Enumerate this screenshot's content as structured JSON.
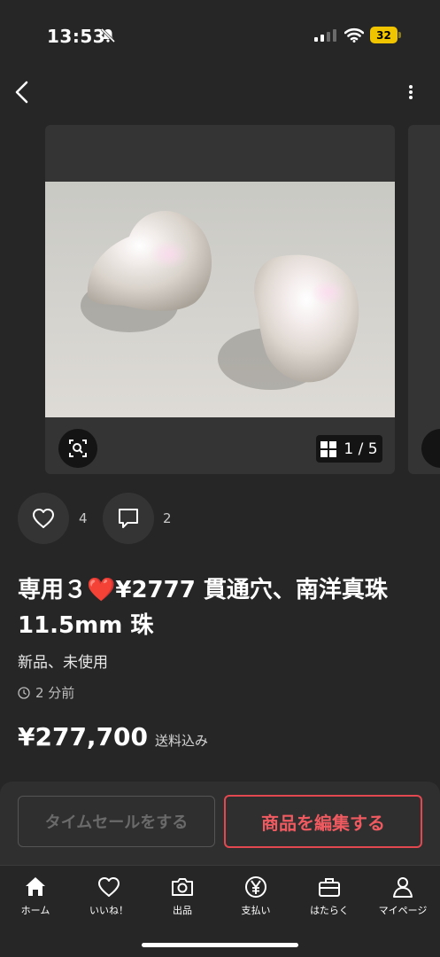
{
  "status_bar": {
    "time": "13:53",
    "battery": "32",
    "battery_color": "#f1c400"
  },
  "nav": {
    "back_icon": "chevron-left-icon",
    "more_icon": "vertical-dots-icon"
  },
  "gallery": {
    "counter_current": "1",
    "counter_separator": "/",
    "counter_total": "5",
    "image_subject": "two white baroque pearls"
  },
  "social": {
    "like_count": "4",
    "comment_count": "2"
  },
  "item": {
    "title": "専用３❤️¥2777 貫通穴、南洋真珠11.5mm 珠",
    "condition": "新品、未使用",
    "posted": "2 分前",
    "price": "¥277,700",
    "shipping": "送料込み"
  },
  "actions": {
    "time_sale_label": "タイムセールをする",
    "edit_label": "商品を編集する",
    "accent_color": "#e34850"
  },
  "tabs": [
    {
      "label": "ホーム",
      "icon": "home-icon"
    },
    {
      "label": "いいね！",
      "icon": "heart-icon"
    },
    {
      "label": "出品",
      "icon": "camera-icon"
    },
    {
      "label": "支払い",
      "icon": "yen-icon"
    },
    {
      "label": "はたらく",
      "icon": "briefcase-icon"
    },
    {
      "label": "マイページ",
      "icon": "person-icon"
    }
  ]
}
